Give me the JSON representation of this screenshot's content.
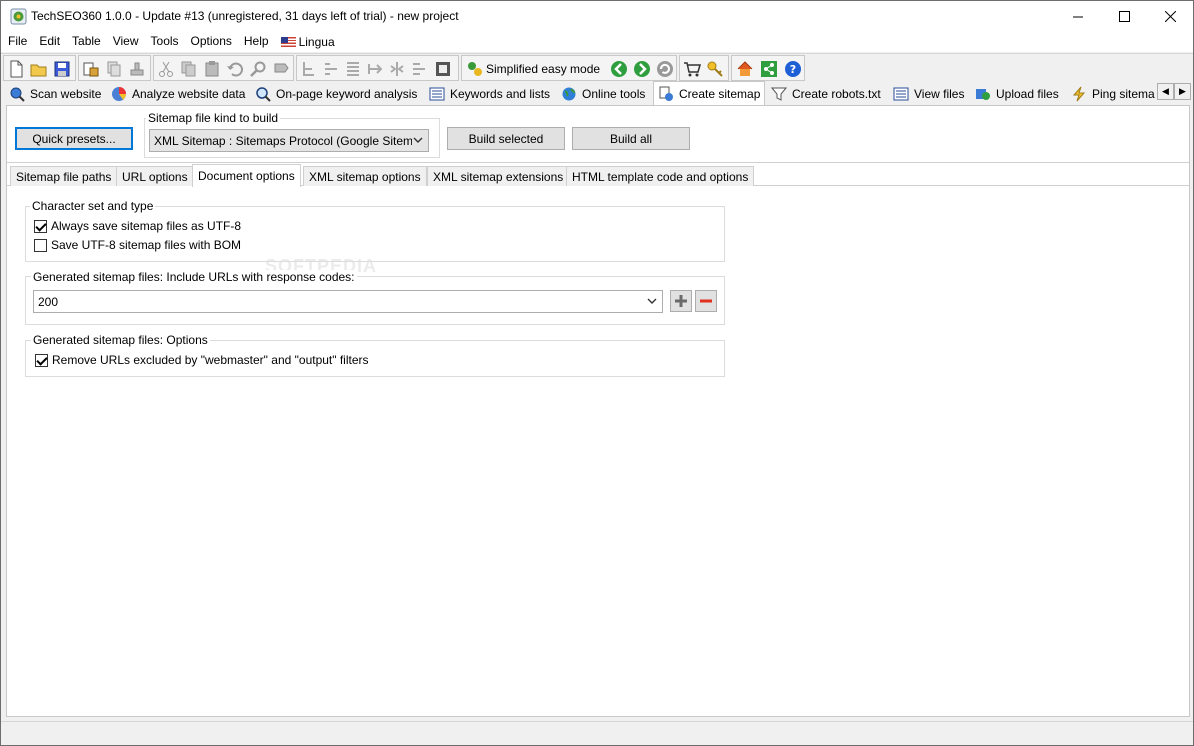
{
  "window": {
    "title": "TechSEO360 1.0.0 - Update #13 (unregistered, 31 days left of trial) - new project"
  },
  "menu": {
    "items": [
      "File",
      "Edit",
      "Table",
      "View",
      "Tools",
      "Options",
      "Help",
      "Lingua"
    ]
  },
  "toolbar": {
    "simplified_label": "Simplified easy mode"
  },
  "main_tabs": [
    {
      "label": "Scan website",
      "icon": "magnifier-globe-icon"
    },
    {
      "label": "Analyze website data",
      "icon": "pie-chart-icon"
    },
    {
      "label": "On-page keyword analysis",
      "icon": "magnifier-icon"
    },
    {
      "label": "Keywords and lists",
      "icon": "list-icon"
    },
    {
      "label": "Online tools",
      "icon": "globe-icon"
    },
    {
      "label": "Create sitemap",
      "icon": "sitemap-icon"
    },
    {
      "label": "Create robots.txt",
      "icon": "filter-icon"
    },
    {
      "label": "View files",
      "icon": "list-icon"
    },
    {
      "label": "Upload files",
      "icon": "upload-globe-icon"
    },
    {
      "label": "Ping sitema",
      "icon": "lightning-icon"
    }
  ],
  "sitemap": {
    "quick_presets_label": "Quick presets...",
    "kind_group_label": "Sitemap file kind to build",
    "kind_value": "XML Sitemap : Sitemaps Protocol (Google Sitema",
    "build_selected_label": "Build selected",
    "build_all_label": "Build all"
  },
  "sub_tabs": [
    {
      "label": "Sitemap file paths"
    },
    {
      "label": "URL options"
    },
    {
      "label": "Document options"
    },
    {
      "label": "XML sitemap options"
    },
    {
      "label": "XML sitemap extensions"
    },
    {
      "label": "HTML template code and options"
    }
  ],
  "watermark": "SOFTPEDIA",
  "document_options": {
    "charset_group": "Character set and type",
    "utf8_label": "Always save sitemap files as UTF-8",
    "utf8_checked": true,
    "bom_label": "Save UTF-8 sitemap files with BOM",
    "bom_checked": false,
    "response_group": "Generated sitemap files: Include URLs with response codes:",
    "response_value": "200",
    "options_group": "Generated sitemap files: Options",
    "remove_label": "Remove URLs excluded by \"webmaster\" and \"output\" filters",
    "remove_checked": true
  },
  "colors": {
    "accent": "#0078d7",
    "add_green": "#6a6a6a",
    "remove_red": "#e0301e"
  }
}
